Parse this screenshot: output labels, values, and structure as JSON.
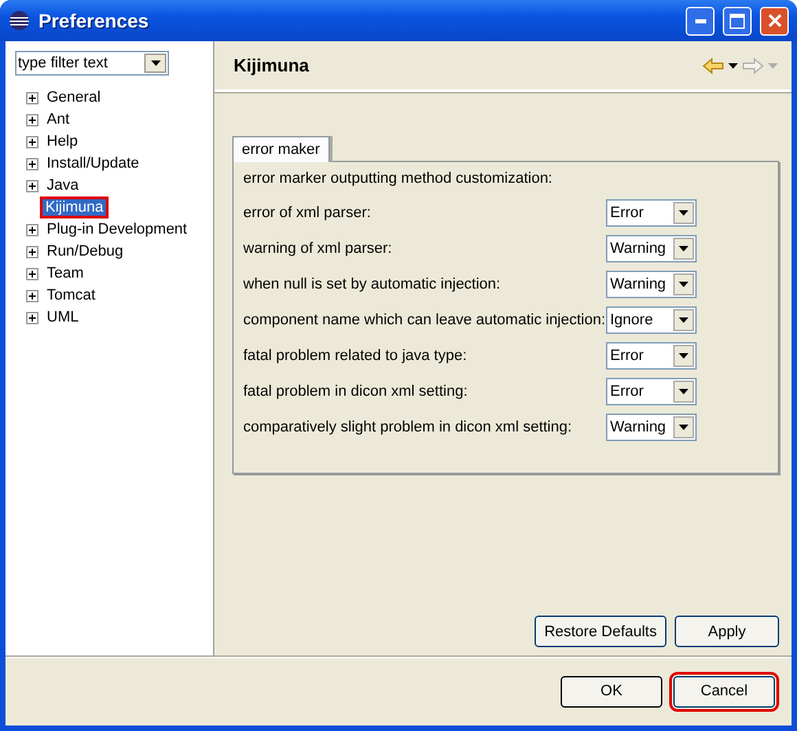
{
  "window": {
    "title": "Preferences"
  },
  "filter": {
    "placeholder": "type filter text"
  },
  "tree": [
    {
      "label": "General",
      "expandable": true,
      "selected": false,
      "highlighted": false
    },
    {
      "label": "Ant",
      "expandable": true,
      "selected": false,
      "highlighted": false
    },
    {
      "label": "Help",
      "expandable": true,
      "selected": false,
      "highlighted": false
    },
    {
      "label": "Install/Update",
      "expandable": true,
      "selected": false,
      "highlighted": false
    },
    {
      "label": "Java",
      "expandable": true,
      "selected": false,
      "highlighted": false
    },
    {
      "label": "Kijimuna",
      "expandable": false,
      "selected": true,
      "highlighted": true
    },
    {
      "label": "Plug-in Development",
      "expandable": true,
      "selected": false,
      "highlighted": false
    },
    {
      "label": "Run/Debug",
      "expandable": true,
      "selected": false,
      "highlighted": false
    },
    {
      "label": "Team",
      "expandable": true,
      "selected": false,
      "highlighted": false
    },
    {
      "label": "Tomcat",
      "expandable": true,
      "selected": false,
      "highlighted": false
    },
    {
      "label": "UML",
      "expandable": true,
      "selected": false,
      "highlighted": false
    }
  ],
  "page": {
    "title": "Kijimuna"
  },
  "tabs": [
    {
      "label": "error maker",
      "selected": true
    }
  ],
  "section": {
    "heading": "error marker outputting method customization:"
  },
  "settings": [
    {
      "label": "error of xml parser:",
      "value": "Error"
    },
    {
      "label": "warning of xml parser:",
      "value": "Warning"
    },
    {
      "label": "when null is set by automatic injection:",
      "value": "Warning"
    },
    {
      "label": "component name which can leave automatic injection:",
      "value": "Ignore"
    },
    {
      "label": "fatal problem related to java type:",
      "value": "Error"
    },
    {
      "label": "fatal problem in dicon xml setting:",
      "value": "Error"
    },
    {
      "label": "comparatively slight problem in dicon xml setting:",
      "value": "Warning"
    }
  ],
  "page_buttons": [
    {
      "label": "Restore Defaults"
    },
    {
      "label": "Apply"
    }
  ],
  "dialog_buttons": [
    {
      "label": "OK",
      "default": true,
      "highlighted": false
    },
    {
      "label": "Cancel",
      "default": false,
      "highlighted": true
    }
  ]
}
